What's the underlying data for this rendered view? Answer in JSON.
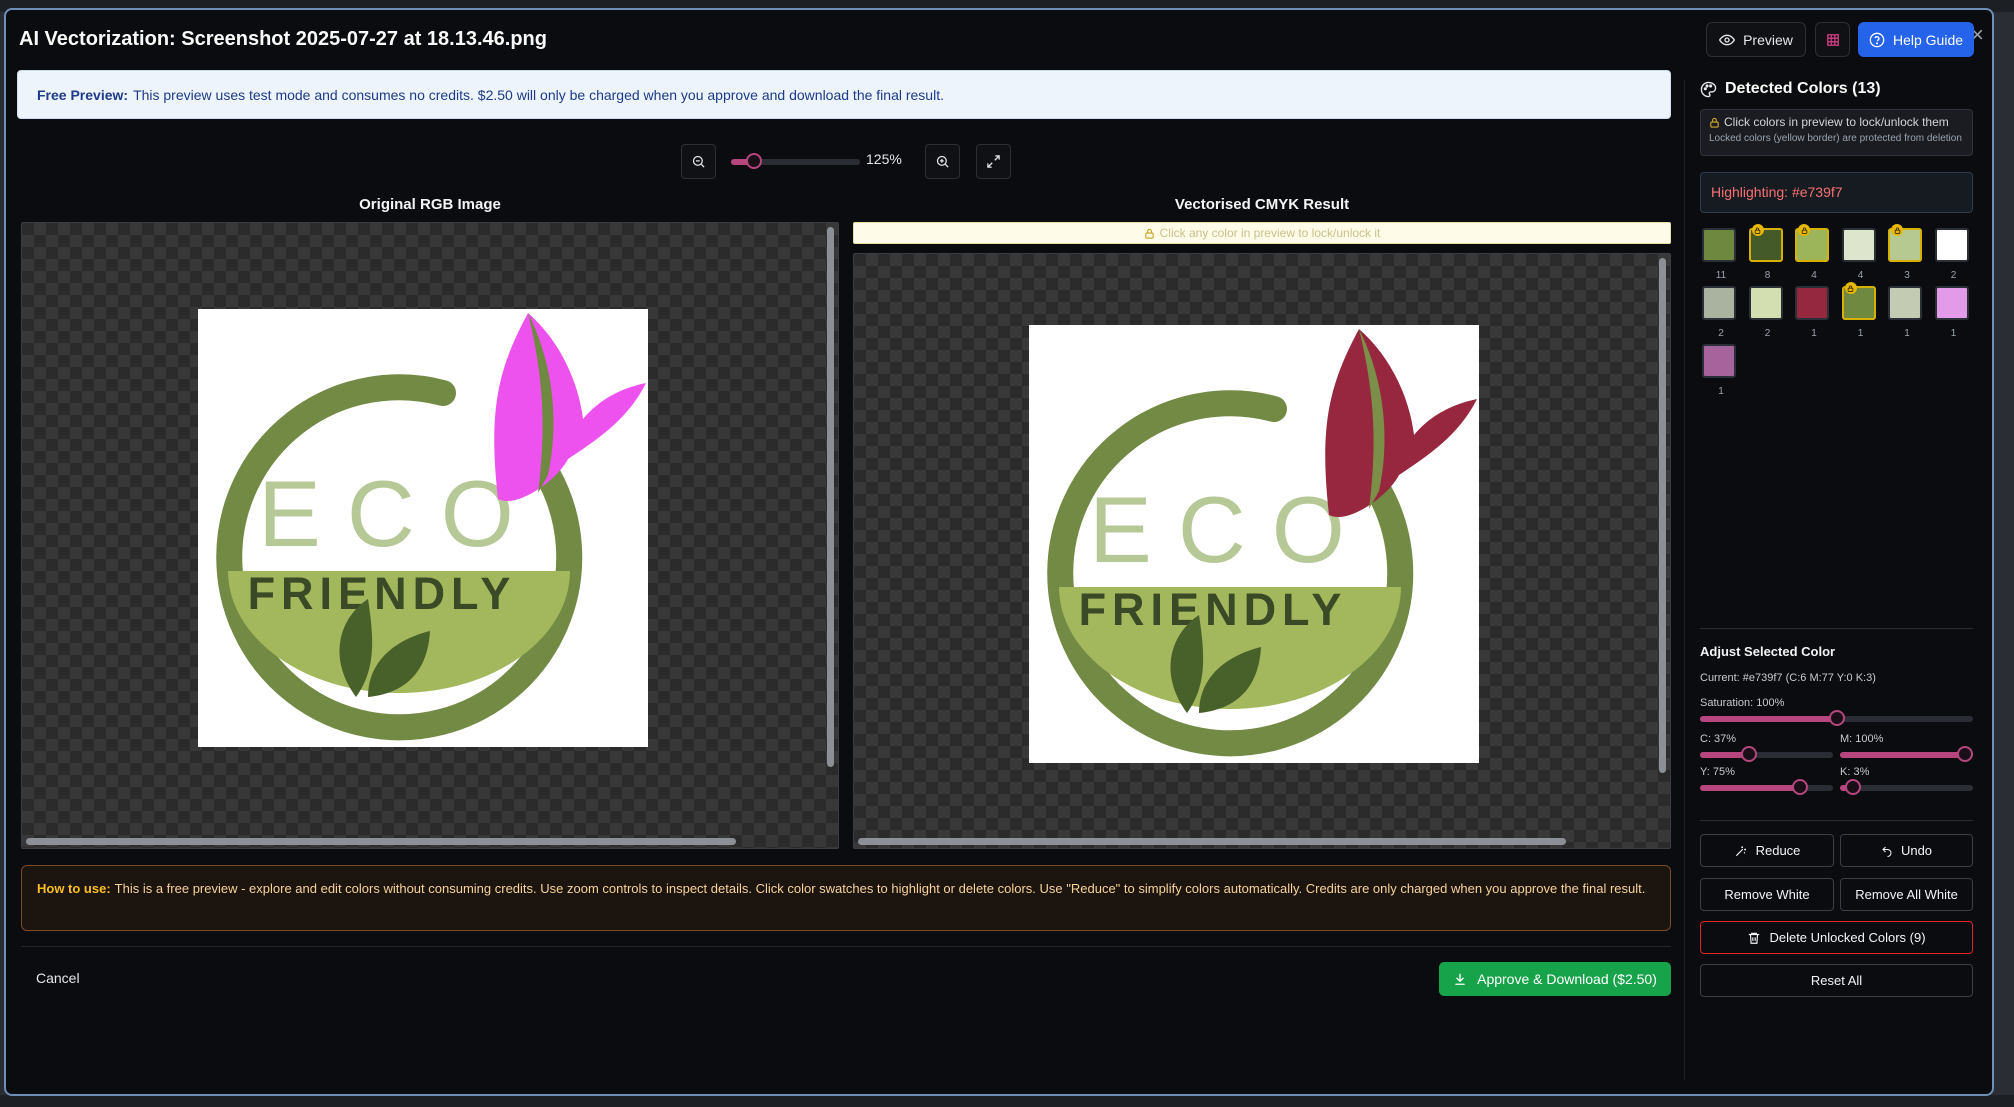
{
  "dialog": {
    "title": "AI Vectorization: Screenshot 2025-07-27 at 18.13.46.png",
    "close_symbol": "×"
  },
  "header": {
    "preview_label": "Preview",
    "help_label": "Help Guide"
  },
  "notice": {
    "bold": "Free Preview:",
    "text": "This preview uses test mode and consumes no credits. $2.50 will only be charged when you approve and download the final result."
  },
  "zoom": {
    "value_label": "125%",
    "level_fraction": 0.18
  },
  "panes": {
    "original_title": "Original RGB Image",
    "result_title": "Vectorised CMYK Result",
    "lock_hint": "Click any color in preview to lock/unlock it"
  },
  "logo": {
    "eco": "ECO",
    "friendly": "FRIENDLY",
    "original_colors": {
      "ring": "#728a44",
      "eco": "#b5c896",
      "bowl": "#a3b75c",
      "text": "#3a4a27",
      "leaf": "#48602a",
      "petal": "#ee52ee",
      "stem": "#6f8940"
    },
    "vector_colors": {
      "ring": "#728a44",
      "eco": "#b5c896",
      "bowl": "#a3b75c",
      "text": "#3a4a27",
      "leaf": "#48602a",
      "petal": "#96273f",
      "stem": "#7b8f48"
    }
  },
  "howto": {
    "bold": "How to use:",
    "text": "This is a free preview - explore and edit colors without consuming credits. Use zoom controls to inspect details. Click color swatches to highlight or delete colors. Use \"Reduce\" to simplify colors automatically. Credits are only charged when you approve the final result."
  },
  "footer": {
    "cancel_label": "Cancel",
    "approve_label": "Approve & Download ($2.50)"
  },
  "sidebar": {
    "title": "Detected Colors (13)",
    "lock_info_line1": "Click colors in preview to lock/unlock them",
    "lock_info_line2": "Locked colors (yellow border) are protected from deletion",
    "highlighting": "Highlighting: #e739f7",
    "swatches": [
      {
        "color": "#6f8840",
        "count": "11",
        "locked": false
      },
      {
        "color": "#445a28",
        "count": "8",
        "locked": true
      },
      {
        "color": "#9cb45a",
        "count": "4",
        "locked": true
      },
      {
        "color": "#dde5cc",
        "count": "4",
        "locked": false
      },
      {
        "color": "#b6c990",
        "count": "3",
        "locked": true
      },
      {
        "color": "#ffffff",
        "count": "2",
        "locked": false
      },
      {
        "color": "#a9b3a0",
        "count": "2",
        "locked": false
      },
      {
        "color": "#d3dfb0",
        "count": "2",
        "locked": false
      },
      {
        "color": "#95273f",
        "count": "1",
        "locked": false
      },
      {
        "color": "#6f8a40",
        "count": "1",
        "locked": true
      },
      {
        "color": "#c4cbb3",
        "count": "1",
        "locked": false
      },
      {
        "color": "#e39ae8",
        "count": "1",
        "locked": false
      },
      {
        "color": "#a7649c",
        "count": "1",
        "locked": false
      }
    ],
    "adjust": {
      "title": "Adjust Selected Color",
      "current": "Current: #e739f7 (C:6 M:77 Y:0 K:3)",
      "saturation_label": "Saturation: 100%",
      "saturation_value": 0.5,
      "c_label": "C: 37%",
      "c_value": 0.37,
      "m_label": "M: 100%",
      "m_value": 1.0,
      "y_label": "Y: 75%",
      "y_value": 0.75,
      "k_label": "K: 3%",
      "k_value": 0.1
    },
    "actions": {
      "reduce_label": "Reduce",
      "undo_label": "Undo",
      "remove_white_label": "Remove White",
      "remove_all_white_label": "Remove All White",
      "delete_unlocked_label": "Delete Unlocked Colors (9)",
      "reset_all_label": "Reset All"
    }
  }
}
